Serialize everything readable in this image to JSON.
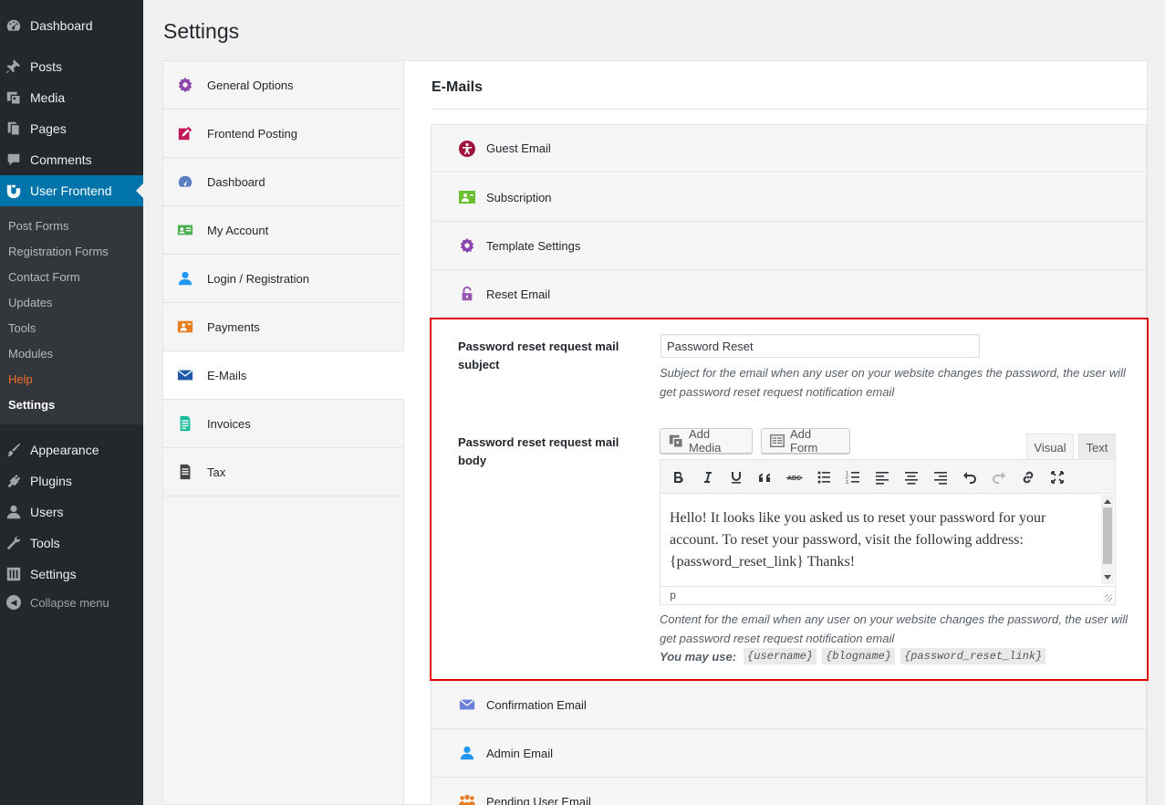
{
  "admin_menu": {
    "items": [
      {
        "label": "Dashboard",
        "icon": "dashboard-icon"
      },
      {
        "label": "Posts",
        "icon": "pushpin-icon"
      },
      {
        "label": "Media",
        "icon": "media-icon"
      },
      {
        "label": "Pages",
        "icon": "pages-icon"
      },
      {
        "label": "Comments",
        "icon": "comment-icon"
      },
      {
        "label": "User Frontend",
        "icon": "user-frontend-icon"
      }
    ],
    "submenu": [
      "Post Forms",
      "Registration Forms",
      "Contact Form",
      "Updates",
      "Tools",
      "Modules",
      "Help",
      "Settings"
    ],
    "items_bottom": [
      {
        "label": "Appearance",
        "icon": "brush-icon"
      },
      {
        "label": "Plugins",
        "icon": "plugin-icon"
      },
      {
        "label": "Users",
        "icon": "users-icon"
      },
      {
        "label": "Tools",
        "icon": "wrench-icon"
      },
      {
        "label": "Settings",
        "icon": "settings-sliders-icon"
      }
    ],
    "collapse": "Collapse menu"
  },
  "page": {
    "title": "Settings"
  },
  "settings_nav": [
    {
      "label": "General Options",
      "icon": "gear-icon"
    },
    {
      "label": "Frontend Posting",
      "icon": "edit-icon"
    },
    {
      "label": "Dashboard",
      "icon": "dashboard-icon"
    },
    {
      "label": "My Account",
      "icon": "id-card-icon"
    },
    {
      "label": "Login / Registration",
      "icon": "user-icon"
    },
    {
      "label": "Payments",
      "icon": "payment-icon"
    },
    {
      "label": "E-Mails",
      "icon": "envelope-icon"
    },
    {
      "label": "Invoices",
      "icon": "invoice-icon"
    },
    {
      "label": "Tax",
      "icon": "tax-document-icon"
    }
  ],
  "colors": {
    "accent": "#0073aa",
    "highlight_border": "#e00000",
    "help_orange": "#f56e28"
  },
  "emails": {
    "heading": "E-Mails",
    "sections_top": [
      {
        "label": "Guest Email",
        "icon": "guest-icon"
      },
      {
        "label": "Subscription",
        "icon": "subscription-icon"
      },
      {
        "label": "Template Settings",
        "icon": "gear-icon"
      },
      {
        "label": "Reset Email",
        "icon": "lock-icon"
      }
    ],
    "sections_bottom": [
      {
        "label": "Confirmation Email",
        "icon": "envelope-icon"
      },
      {
        "label": "Admin Email",
        "icon": "user-icon"
      },
      {
        "label": "Pending User Email",
        "icon": "group-icon"
      }
    ]
  },
  "reset": {
    "subject_label": "Password reset request mail subject",
    "subject_value": "Password Reset",
    "subject_desc": "Subject for the email when any user on your website changes the password, the user will get password reset request notification email",
    "body_label": "Password reset request mail body",
    "add_media": "Add Media",
    "add_form": "Add Form",
    "tab_visual": "Visual",
    "tab_text": "Text",
    "toolbar": [
      "bold",
      "italic",
      "underline",
      "blockquote",
      "strikethrough",
      "bullet-list",
      "numbered-list",
      "align-left",
      "align-center",
      "align-right",
      "undo",
      "redo",
      "link",
      "fullscreen"
    ],
    "body_text": "Hello! It looks like you asked us to reset your password for your account. To reset your password, visit the following address: {password_reset_link} Thanks!",
    "status_path": "p",
    "body_desc": "Content for the email when any user on your website changes the password, the user will get password reset request notification email",
    "you_may_use": "You may use:",
    "tags": [
      "{username}",
      "{blogname}",
      "{password_reset_link}"
    ]
  }
}
